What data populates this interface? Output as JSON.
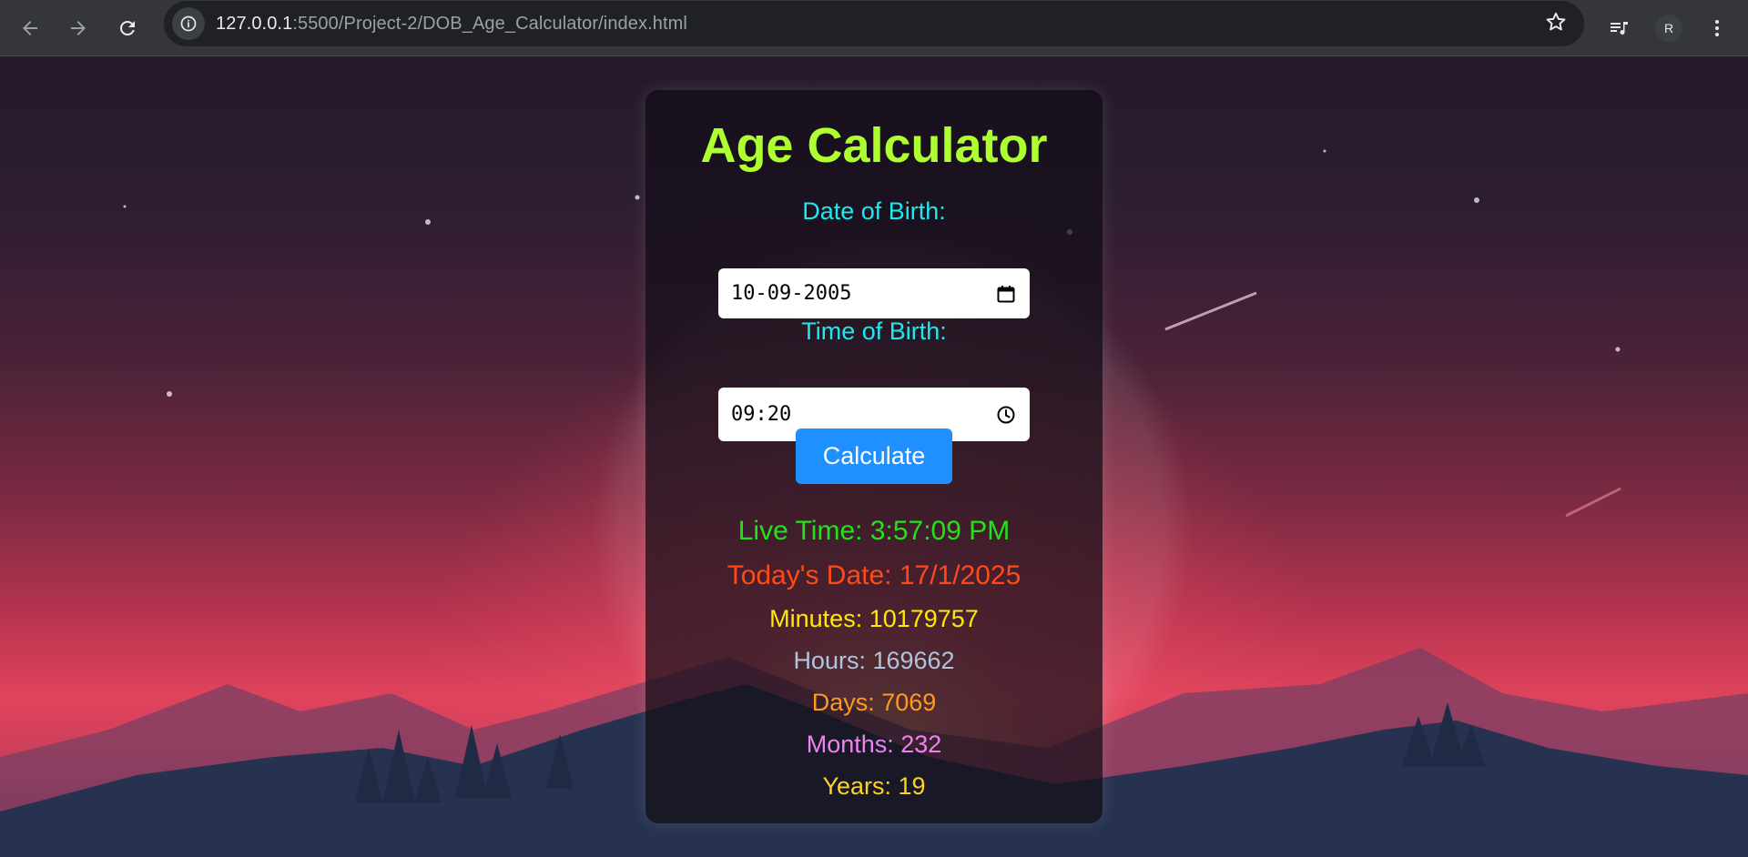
{
  "browser": {
    "url_host": "127.0.0.1",
    "url_rest": ":5500/Project-2/DOB_Age_Calculator/index.html",
    "profile_initial": "R"
  },
  "app": {
    "title": "Age Calculator",
    "dob_label": "Date of Birth:",
    "dob_value": "10-09-2005",
    "tob_label": "Time of Birth:",
    "tob_value": "09:20",
    "calculate_label": "Calculate"
  },
  "results": {
    "live_time": "Live Time: 3:57:09 PM",
    "todays_date": "Today's Date: 17/1/2025",
    "minutes": "Minutes: 10179757",
    "hours": "Hours: 169662",
    "days": "Days: 7069",
    "months": "Months: 232",
    "years": "Years: 19"
  },
  "colors": {
    "title": "#adff2f",
    "label": "#1de9f0",
    "button": "#1e90ff",
    "live_time": "#22e31a",
    "todays_date": "#ff4a17",
    "minutes": "#ffea00",
    "hours": "#b0c4de",
    "days": "#ff9a1f",
    "months": "#ee82ee",
    "years": "#ffd21f"
  },
  "icons": {
    "back": "arrow-left-icon",
    "forward": "arrow-right-icon",
    "reload": "reload-icon",
    "site_info": "info-icon",
    "bookmark": "star-icon",
    "media": "media-queue-icon",
    "menu": "kebab-menu-icon",
    "calendar": "calendar-icon",
    "clock": "clock-icon"
  }
}
